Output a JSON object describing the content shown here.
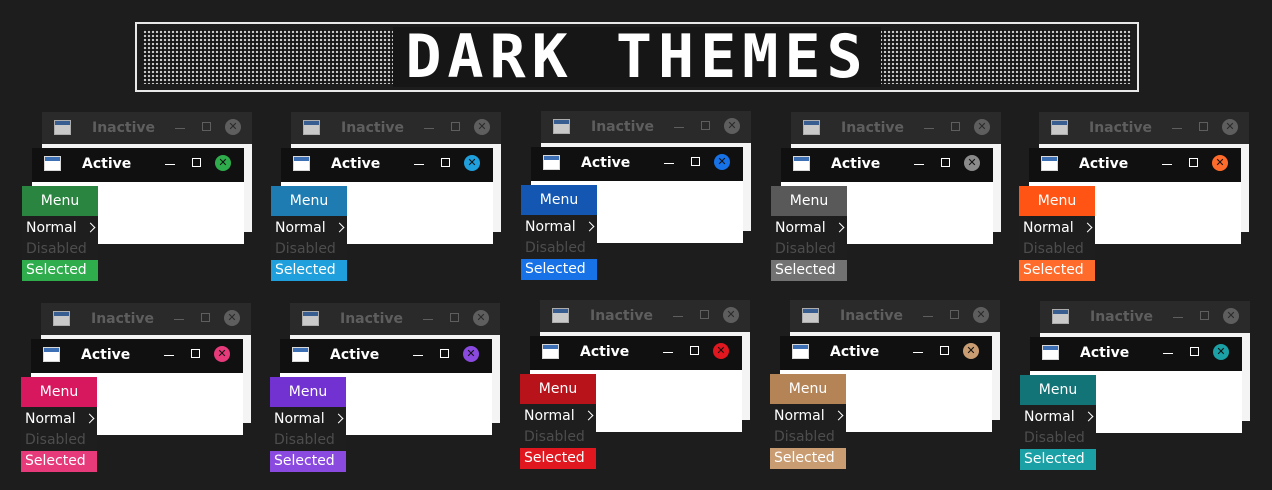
{
  "banner": {
    "title": "DARK THEMES"
  },
  "labels": {
    "inactive_title": "Inactive",
    "active_title": "Active",
    "menu": "Menu",
    "normal": "Normal",
    "disabled": "Disabled",
    "selected": "Selected"
  },
  "themes": [
    {
      "id": "green",
      "menu_color": "#2a8540",
      "selected_color": "#2fac4c",
      "close_color": "#2fac4c"
    },
    {
      "id": "blue",
      "menu_color": "#1e7cb2",
      "selected_color": "#1f9fdc",
      "close_color": "#1f9fdc"
    },
    {
      "id": "navy",
      "menu_color": "#1457b3",
      "selected_color": "#1672e6",
      "close_color": "#1672e6"
    },
    {
      "id": "gray",
      "menu_color": "#595959",
      "selected_color": "#727272",
      "close_color": "#8a8a8a"
    },
    {
      "id": "orange",
      "menu_color": "#ff5413",
      "selected_color": "#ff6b2a",
      "close_color": "#ff6b2a"
    },
    {
      "id": "pink",
      "menu_color": "#d8185e",
      "selected_color": "#e73a7b",
      "close_color": "#e73a7b"
    },
    {
      "id": "purple",
      "menu_color": "#7232d1",
      "selected_color": "#8a4ae0",
      "close_color": "#8a4ae0"
    },
    {
      "id": "red",
      "menu_color": "#b8121a",
      "selected_color": "#e0171f",
      "close_color": "#e0171f"
    },
    {
      "id": "tan",
      "menu_color": "#b48457",
      "selected_color": "#c99c72",
      "close_color": "#c99c72"
    },
    {
      "id": "teal",
      "menu_color": "#137477",
      "selected_color": "#1ba0a5",
      "close_color": "#1ba0a5"
    }
  ]
}
